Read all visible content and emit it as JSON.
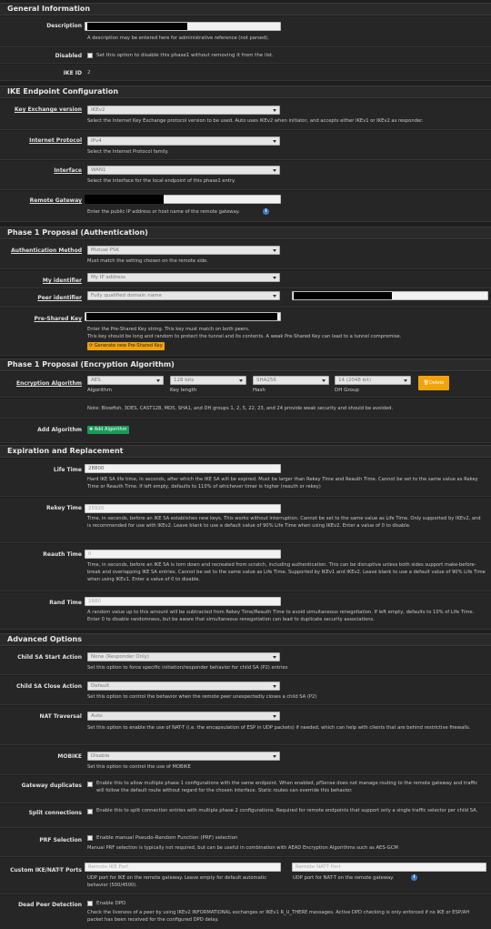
{
  "general": {
    "title": "General Information",
    "desc_label": "Description",
    "desc_help": "A description may be entered here for administrative reference (not parsed).",
    "disabled_label": "Disabled",
    "disabled_text": "Set this option to disable this phase1 without removing it from the list.",
    "ikeid_label": "IKE ID",
    "ikeid_value": "2"
  },
  "endpoint": {
    "title": "IKE Endpoint Configuration",
    "kx_label": "Key Exchange version",
    "kx_value": "IKEv2",
    "kx_help": "Select the Internet Key Exchange protocol version to be used. Auto uses IKEv2 when initiator, and accepts either IKEv1 or IKEv2 as responder.",
    "proto_label": "Internet Protocol",
    "proto_value": "IPv4",
    "proto_help": "Select the Internet Protocol family.",
    "iface_label": "Interface",
    "iface_value": "WAN1",
    "iface_help": "Select the interface for the local endpoint of this phase1 entry.",
    "gw_label": "Remote Gateway",
    "gw_help": "Enter the public IP address or host name of the remote gateway."
  },
  "auth": {
    "title": "Phase 1 Proposal (Authentication)",
    "method_label": "Authentication Method",
    "method_value": "Mutual PSK",
    "method_help": "Must match the setting chosen on the remote side.",
    "myid_label": "My identifier",
    "myid_value": "My IP address",
    "peerid_label": "Peer identifier",
    "peerid_value": "Fully qualified domain name",
    "psk_label": "Pre-Shared Key",
    "psk_help1": "Enter the Pre-Shared Key string. This key must match on both peers.",
    "psk_help2": "This key should be long and random to protect the tunnel and its contents. A weak Pre-Shared Key can lead to a tunnel compromise.",
    "gen_btn": "Generate new Pre-Shared Key"
  },
  "enc": {
    "title": "Phase 1 Proposal (Encryption Algorithm)",
    "alg_label": "Encryption Algorithm",
    "alg": "AES",
    "keylen": "128 bits",
    "hash": "SHA256",
    "dh": "14 (2048 bit)",
    "sub_alg": "Algorithm",
    "sub_keylen": "Key length",
    "sub_hash": "Hash",
    "sub_dh": "DH Group",
    "delete_btn": "Delete",
    "note": "Note: Blowfish, 3DES, CAST128, MD5, SHA1, and DH groups 1, 2, 5, 22, 23, and 24 provide weak security and should be avoided.",
    "add_label": "Add Algorithm",
    "add_btn": "Add Algorithm"
  },
  "exp": {
    "title": "Expiration and Replacement",
    "life_label": "Life Time",
    "life_value": "28800",
    "life_help": "Hard IKE SA life time, in seconds, after which the IKE SA will be expired. Must be larger than Rekey Time and Reauth Time. Cannot be set to the same value as Rekey Time or Reauth Time. If left empty, defaults to 110% of whichever timer is higher (reauth or rekey)",
    "rekey_label": "Rekey Time",
    "rekey_value": "25920",
    "rekey_help": "Time, in seconds, before an IKE SA establishes new keys. This works without interruption. Cannot be set to the same value as Life Time. Only supported by IKEv2, and is recommended for use with IKEv2. Leave blank to use a default value of 90% Life Time when using IKEv2. Enter a value of 0 to disable.",
    "reauth_label": "Reauth Time",
    "reauth_value": "0",
    "reauth_help": "Time, in seconds, before an IKE SA is torn down and recreated from scratch, including authentication. This can be disruptive unless both sides support make-before-break and overlapping IKE SA entries. Cannot be set to the same value as Life Time. Supported by IKEv1 and IKEv2. Leave blank to use a default value of 90% Life Time when using IKEv1. Enter a value of 0 to disable.",
    "rand_label": "Rand Time",
    "rand_value": "2880",
    "rand_help": "A random value up to this amount will be subtracted from Rekey Time/Reauth Time to avoid simultaneous renegotiation. If left empty, defaults to 10% of Life Time. Enter 0 to disable randomness, but be aware that simultaneous renegotiation can lead to duplicate security associations."
  },
  "adv": {
    "title": "Advanced Options",
    "csa_start_label": "Child SA Start Action",
    "csa_start_value": "None (Responder Only)",
    "csa_start_help": "Set this option to force specific initiation/responder behavior for child SA (P2) entries",
    "csa_close_label": "Child SA Close Action",
    "csa_close_value": "Default",
    "csa_close_help": "Set this option to control the behavior when the remote peer unexpectedly closes a child SA (P2)",
    "nat_label": "NAT Traversal",
    "nat_value": "Auto",
    "nat_help": "Set this option to enable the use of NAT-T (i.e. the encapsulation of ESP in UDP packets) if needed, which can help with clients that are behind restrictive firewalls.",
    "mobike_label": "MOBIKE",
    "mobike_value": "Disable",
    "mobike_help": "Set this option to control the use of MOBIKE",
    "gwdup_label": "Gateway duplicates",
    "gwdup_text": "Enable this to allow multiple phase 1 configurations with the same endpoint. When enabled, pfSense does not manage routing to the remote gateway and traffic will follow the default route without regard for the chosen interface. Static routes can override this behavior.",
    "split_label": "Split connections",
    "split_text": "Enable this to split connection entries with multiple phase 2 configurations. Required for remote endpoints that support only a single traffic selector per child SA.",
    "prf_label": "PRF Selection",
    "prf_text": "Enable manual Pseudo-Random Function (PRF) selection",
    "prf_help": "Manual PRF selection is typically not required, but can be useful in combination with AEAD Encryption Algorithms such as AES-GCM",
    "ports_label": "Custom IKE/NAT-T Ports",
    "ike_port_ph": "Remote IKE Port",
    "natt_port_ph": "Remote NATT Port",
    "ike_port_help": "UDP port for IKE on the remote gateway. Leave empty for default automatic behavior (500/4500).",
    "natt_port_help": "UDP port for NAT-T on the remote gateway.",
    "dpd_label": "Dead Peer Detection",
    "dpd_text": "Enable DPD",
    "dpd_help": "Check the liveness of a peer by using IKEv2 INFORMATIONAL exchanges or IKEv1 R_U_THERE messages. Active DPD checking is only enforced if no IKE or ESP/AH packet has been received for the configured DPD delay."
  },
  "colors": {
    "bg": "#1e1e1e",
    "header": "#2a2a2a",
    "input": "#f2f2f2",
    "orange": "#f0a30a",
    "green": "#1a9a5a",
    "info": "#3c7fc7"
  }
}
